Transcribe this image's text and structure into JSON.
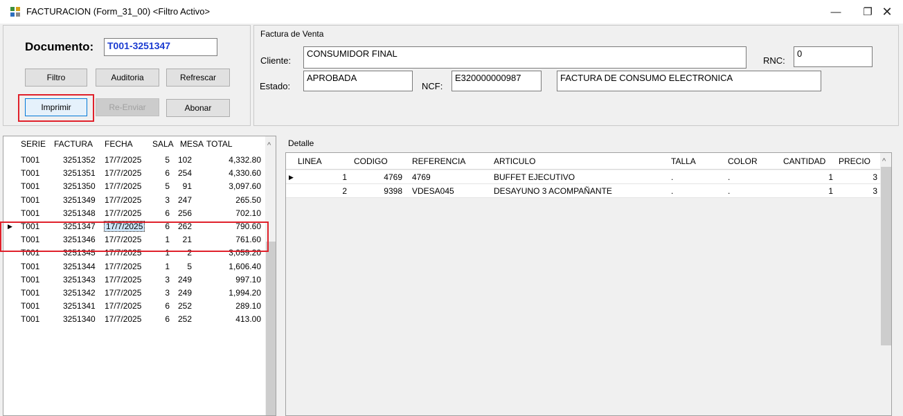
{
  "window": {
    "title": "FACTURACION (Form_31_00) <Filtro Activo>",
    "minimize": "—",
    "maximize": "❐",
    "close": "✕"
  },
  "document": {
    "label": "Documento:",
    "value": "T001-3251347"
  },
  "buttons": {
    "filtro": "Filtro",
    "auditoria": "Auditoria",
    "refrescar": "Refrescar",
    "imprimir": "Imprimir",
    "reenviar": "Re-Enviar",
    "abonar": "Abonar"
  },
  "factura": {
    "legend": "Factura de Venta",
    "cliente_label": "Cliente:",
    "cliente": "CONSUMIDOR FINAL",
    "rnc_label": "RNC:",
    "rnc": "0",
    "estado_label": "Estado:",
    "estado": "APROBADA",
    "ncf_label": "NCF:",
    "ncf": "E320000000987",
    "descripcion": "FACTURA DE CONSUMO ELECTRONICA"
  },
  "invoices": {
    "headers": [
      "SERIE",
      "FACTURA",
      "FECHA",
      "SALA",
      "MESA",
      "TOTAL"
    ],
    "rows": [
      [
        "T001",
        "3251352",
        "17/7/2025",
        "5",
        "102",
        "4,332.80"
      ],
      [
        "T001",
        "3251351",
        "17/7/2025",
        "6",
        "254",
        "4,330.60"
      ],
      [
        "T001",
        "3251350",
        "17/7/2025",
        "5",
        "91",
        "3,097.60"
      ],
      [
        "T001",
        "3251349",
        "17/7/2025",
        "3",
        "247",
        "265.50"
      ],
      [
        "T001",
        "3251348",
        "17/7/2025",
        "6",
        "256",
        "702.10"
      ],
      [
        "T001",
        "3251347",
        "17/7/2025",
        "6",
        "262",
        "790.60"
      ],
      [
        "T001",
        "3251346",
        "17/7/2025",
        "1",
        "21",
        "761.60"
      ],
      [
        "T001",
        "3251345",
        "17/7/2025",
        "1",
        "2",
        "3,059.20"
      ],
      [
        "T001",
        "3251344",
        "17/7/2025",
        "1",
        "5",
        "1,606.40"
      ],
      [
        "T001",
        "3251343",
        "17/7/2025",
        "3",
        "249",
        "997.10"
      ],
      [
        "T001",
        "3251342",
        "17/7/2025",
        "3",
        "249",
        "1,994.20"
      ],
      [
        "T001",
        "3251341",
        "17/7/2025",
        "6",
        "252",
        "289.10"
      ],
      [
        "T001",
        "3251340",
        "17/7/2025",
        "6",
        "252",
        "413.00"
      ]
    ],
    "selected_index": 5
  },
  "detalle": {
    "legend": "Detalle",
    "headers": [
      "LINEA",
      "CODIGO",
      "REFERENCIA",
      "ARTICULO",
      "TALLA",
      "COLOR",
      "CANTIDAD",
      "PRECIO"
    ],
    "rows": [
      [
        "1",
        "4769",
        "4769",
        "BUFFET EJECUTIVO",
        ".",
        ".",
        "1",
        "3"
      ],
      [
        "2",
        "9398",
        "VDESA045",
        "DESAYUNO 3 ACOMPAÑANTE",
        ".",
        ".",
        "1",
        "3"
      ]
    ]
  },
  "icons": {
    "app": "app-icon",
    "row_pointer": "▶",
    "scroll_up": "^"
  }
}
